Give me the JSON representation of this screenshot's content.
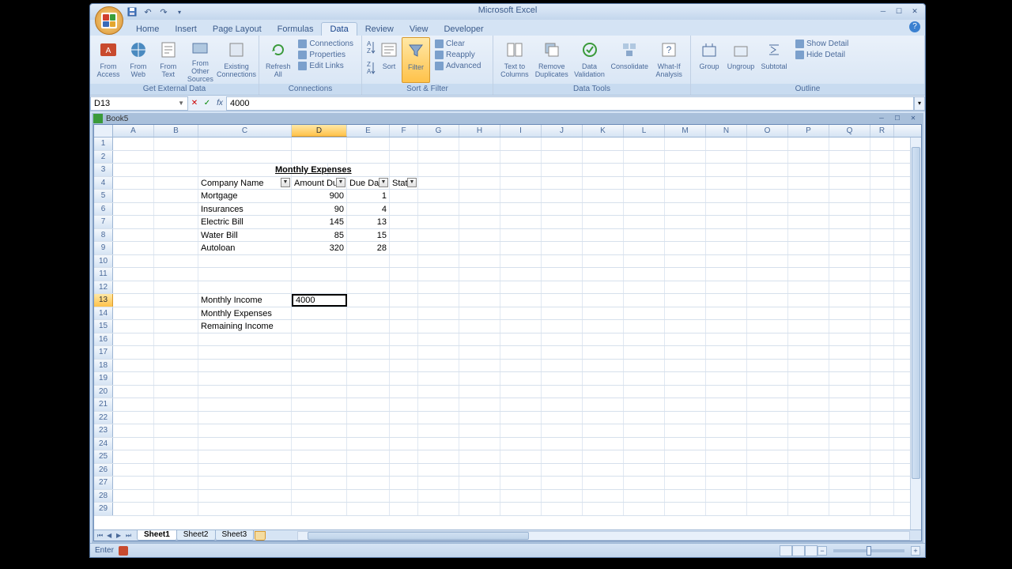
{
  "app": {
    "title": "Microsoft Excel"
  },
  "window": {
    "min": "─",
    "max": "☐",
    "close": "✕"
  },
  "qat": {
    "save": "💾",
    "undo": "↶",
    "redo": "↷"
  },
  "tabs": [
    "Home",
    "Insert",
    "Page Layout",
    "Formulas",
    "Data",
    "Review",
    "View",
    "Developer"
  ],
  "active_tab_index": 4,
  "ribbon": {
    "ext_data": {
      "label": "Get External Data",
      "from_access": "From\nAccess",
      "from_web": "From\nWeb",
      "from_text": "From\nText",
      "from_other": "From Other\nSources",
      "existing": "Existing\nConnections"
    },
    "connections": {
      "label": "Connections",
      "refresh": "Refresh\nAll",
      "connections": "Connections",
      "properties": "Properties",
      "edit_links": "Edit Links"
    },
    "sort_filter": {
      "label": "Sort & Filter",
      "sort": "Sort",
      "filter": "Filter",
      "clear": "Clear",
      "reapply": "Reapply",
      "advanced": "Advanced"
    },
    "data_tools": {
      "label": "Data Tools",
      "text_to_cols": "Text to\nColumns",
      "remove_dup": "Remove\nDuplicates",
      "validation": "Data\nValidation",
      "consolidate": "Consolidate",
      "what_if": "What-If\nAnalysis"
    },
    "outline": {
      "label": "Outline",
      "group": "Group",
      "ungroup": "Ungroup",
      "subtotal": "Subtotal",
      "show_detail": "Show Detail",
      "hide_detail": "Hide Detail"
    }
  },
  "formula_bar": {
    "name_box": "D13",
    "formula": "4000"
  },
  "workbook": {
    "title": "Book5"
  },
  "columns": [
    "A",
    "B",
    "C",
    "D",
    "E",
    "F",
    "G",
    "H",
    "I",
    "J",
    "K",
    "L",
    "M",
    "N",
    "O",
    "P",
    "Q",
    "R"
  ],
  "selected_col": "D",
  "selected_row": 13,
  "cells": {
    "title_row": 3,
    "title_col": "D",
    "title": "Monthly Expenses",
    "headers": {
      "row": 4,
      "company": "Company Name",
      "amount": "Amount Du",
      "due": "Due Da",
      "status": "Stat"
    },
    "data_rows": [
      {
        "row": 5,
        "company": "Mortgage",
        "amount": "900",
        "due": "1"
      },
      {
        "row": 6,
        "company": "Insurances",
        "amount": "90",
        "due": "4"
      },
      {
        "row": 7,
        "company": "Electric Bill",
        "amount": "145",
        "due": "13"
      },
      {
        "row": 8,
        "company": "Water Bill",
        "amount": "85",
        "due": "15"
      },
      {
        "row": 9,
        "company": "Autoloan",
        "amount": "320",
        "due": "28"
      }
    ],
    "summary": [
      {
        "row": 13,
        "label": "Monthly Income",
        "value": "4000"
      },
      {
        "row": 14,
        "label": "Monthly Expenses",
        "value": ""
      },
      {
        "row": 15,
        "label": "Remaining Income",
        "value": ""
      }
    ]
  },
  "sheets": [
    "Sheet1",
    "Sheet2",
    "Sheet3"
  ],
  "active_sheet": 0,
  "status": {
    "mode": "Enter"
  },
  "chart_data": {
    "type": "table",
    "title": "Monthly Expenses",
    "columns": [
      "Company Name",
      "Amount Due",
      "Due Date",
      "Status"
    ],
    "rows": [
      [
        "Mortgage",
        900,
        1,
        ""
      ],
      [
        "Insurances",
        90,
        4,
        ""
      ],
      [
        "Electric Bill",
        145,
        13,
        ""
      ],
      [
        "Water Bill",
        85,
        15,
        ""
      ],
      [
        "Autoloan",
        320,
        28,
        ""
      ]
    ],
    "summary": {
      "Monthly Income": 4000,
      "Monthly Expenses": null,
      "Remaining Income": null
    }
  }
}
